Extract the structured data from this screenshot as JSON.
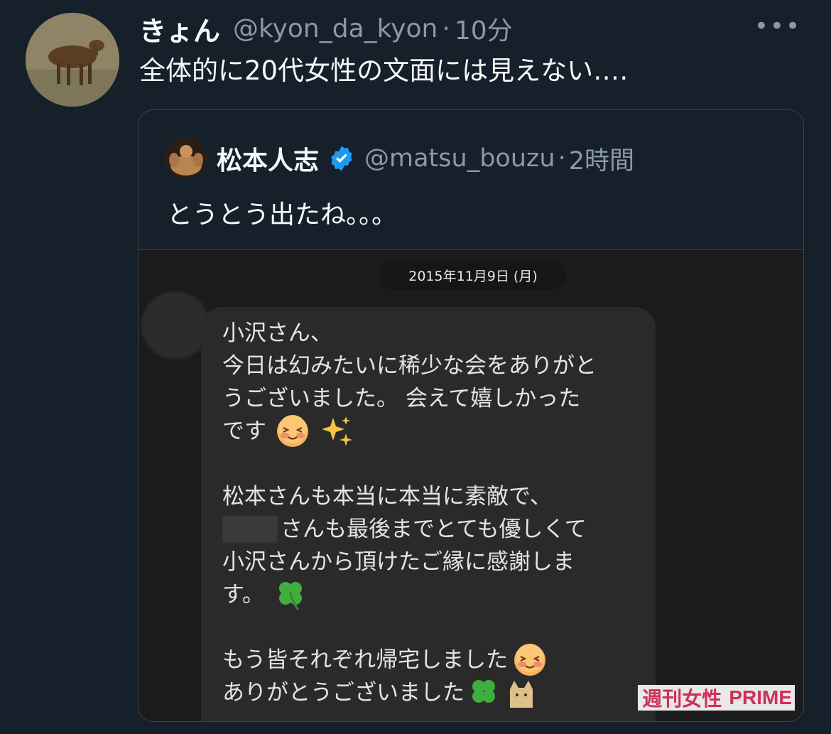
{
  "tweet": {
    "display_name": "きょん",
    "handle": "@kyon_da_kyon",
    "separator": "·",
    "time": "10分",
    "more": "•••",
    "text": "全体的に20代女性の文面には見えない‥‥"
  },
  "quote": {
    "display_name": "松本人志",
    "handle": "@matsu_bouzu",
    "separator": "·",
    "time": "2時間",
    "text": "とうとう出たね。。。"
  },
  "media": {
    "date": "2015年11月9日 (月)",
    "message_lines": [
      "小沢さん、",
      "今日は幻みたいに稀少な会をありがと",
      "うございました。 会えて嬉しかった",
      "です",
      "",
      "松本さんも本当に本当に素敵で、",
      "さんも最後までとても優しくて",
      "小沢さんから頂けたご縁に感謝しま",
      "す。",
      "",
      "もう皆それぞれ帰宅しました",
      "ありがとうございました"
    ],
    "watermark": {
      "part1": "週刊女性",
      "part2": "PRIME"
    }
  },
  "colors": {
    "background": "#15202b",
    "text": "#f7f9f9",
    "muted": "#8b98a5",
    "border": "#38444d",
    "verified": "#1d9bf0",
    "bubble": "#2a2a2b",
    "watermark": "#d8325a"
  }
}
